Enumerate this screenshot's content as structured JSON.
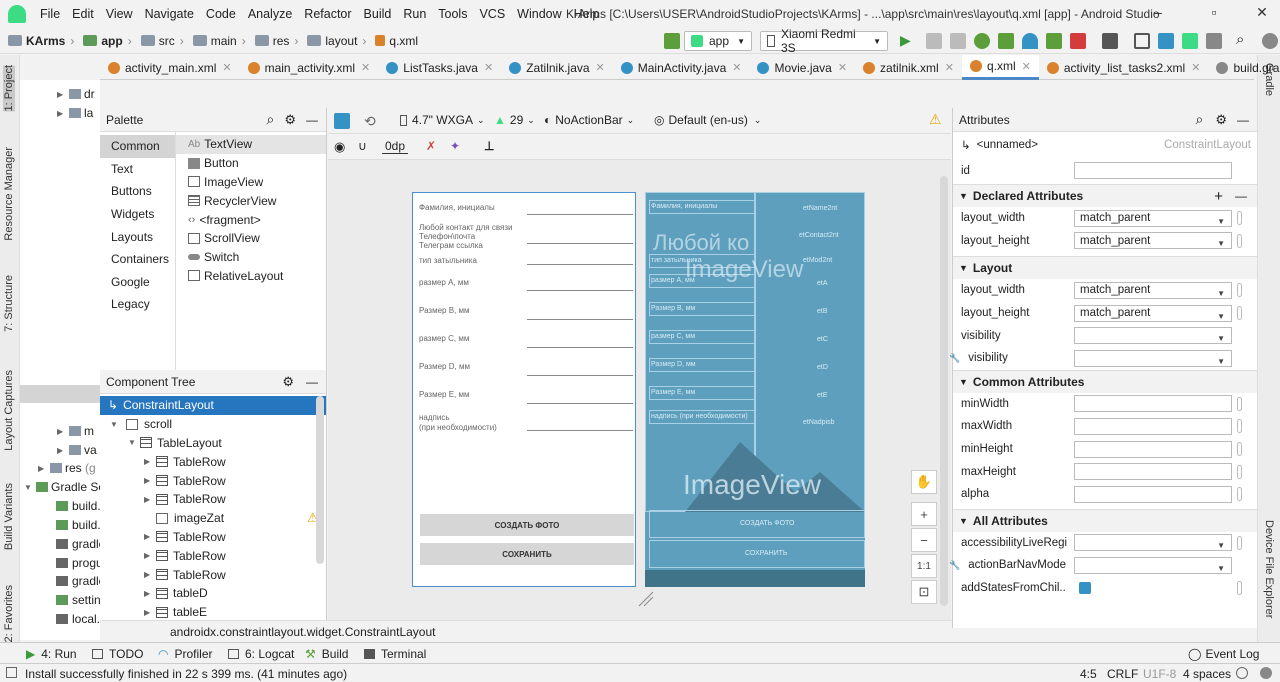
{
  "menubar": {
    "items": [
      "File",
      "Edit",
      "View",
      "Navigate",
      "Code",
      "Analyze",
      "Refactor",
      "Build",
      "Run",
      "Tools",
      "VCS",
      "Window",
      "Help"
    ],
    "title": "K-Arms [C:\\Users\\USER\\AndroidStudioProjects\\KArms] - ...\\app\\src\\main\\res\\layout\\q.xml [app] - Android Studio"
  },
  "breadcrumbs": [
    "KArms",
    "app",
    "src",
    "main",
    "res",
    "layout",
    "q.xml"
  ],
  "toolbar": {
    "run_config": "app",
    "device": "Xiaomi Redmi 3S"
  },
  "tabs": [
    {
      "label": "activity_main.xml",
      "color": "#d9822b"
    },
    {
      "label": "main_activity.xml",
      "color": "#d9822b"
    },
    {
      "label": "ListTasks.java",
      "color": "#3592c4"
    },
    {
      "label": "Zatilnik.java",
      "color": "#3592c4"
    },
    {
      "label": "MainActivity.java",
      "color": "#3592c4"
    },
    {
      "label": "Movie.java",
      "color": "#3592c4"
    },
    {
      "label": "zatilnik.xml",
      "color": "#d9822b"
    },
    {
      "label": "q.xml",
      "color": "#d9822b",
      "active": true
    },
    {
      "label": "activity_list_tasks2.xml",
      "color": "#d9822b"
    },
    {
      "label": "build.gra",
      "color": "#888888"
    }
  ],
  "left_strip": [
    "1: Project",
    "Resource Manager",
    "7: Structure",
    "Layout Captures",
    "Build Variants",
    "2: Favorites"
  ],
  "right_strip": [
    "Gradle",
    "Device File Explorer"
  ],
  "project": {
    "items": [
      "dr",
      "la",
      "m",
      "va",
      "res",
      "Gradle Sc",
      "build.",
      "build.",
      "gradle",
      "progu",
      "gradle",
      "settin",
      "local."
    ],
    "res_suffix": "(g"
  },
  "palette": {
    "title": "Palette",
    "categories": [
      "Common",
      "Text",
      "Buttons",
      "Widgets",
      "Layouts",
      "Containers",
      "Google",
      "Legacy"
    ],
    "widgets": [
      "TextView",
      "Button",
      "ImageView",
      "RecyclerView",
      "<fragment>",
      "ScrollView",
      "Switch",
      "RelativeLayout"
    ],
    "textview_prefix": "Ab"
  },
  "component_tree": {
    "title": "Component Tree",
    "rows": [
      "ConstraintLayout",
      "scroll",
      "TableLayout",
      "TableRow",
      "TableRow",
      "TableRow",
      "imageZat",
      "TableRow",
      "TableRow",
      "TableRow",
      "tableD",
      "tableE"
    ]
  },
  "design_toolbar": {
    "device": "4.7\" WXGA",
    "api": "29",
    "theme": "NoActionBar",
    "locale": "Default (en-us)",
    "margin": "0dp"
  },
  "phone": {
    "labels": [
      "Фамилия, инициалы",
      "Любой контакт для связи",
      "Телефон\\почта",
      "Телеграм ссылка",
      "тип затыльника",
      "размер А, мм",
      "Размер В, мм",
      "размер С, мм",
      "Размер D, мм",
      "Размер Е, мм",
      "надпись",
      "(при необходимости)"
    ],
    "buttons": [
      "СОЗДАТЬ ФОТО",
      "СОХРАНИТЬ"
    ]
  },
  "blueprint": {
    "left_labels": [
      "Фамилия, инициалы",
      "тип затыльника",
      "размер А, мм",
      "Размер В, мм",
      "размер С, мм",
      "Размер D, мм",
      "Размер Е, мм",
      "надпись (при необходимости)"
    ],
    "right_labels": [
      "etName2nt",
      "etContact2nt",
      "etMod2nt",
      "etA",
      "etB",
      "etC",
      "etD",
      "etE",
      "etNadpisb"
    ],
    "big_text_1": "Любой ко",
    "big_text_2": "ImageView",
    "image_view": "ImageView",
    "buttons": [
      "СОЗДАТЬ ФОТО",
      "СОХРАНИТЬ"
    ]
  },
  "zoom": {
    "one_to_one": "1:1"
  },
  "attributes": {
    "title": "Attributes",
    "component": "<unnamed>",
    "component_type": "ConstraintLayout",
    "id_label": "id",
    "sections": {
      "declared": "Declared Attributes",
      "layout": "Layout",
      "common": "Common Attributes",
      "all": "All Attributes"
    },
    "declared_rows": [
      {
        "name": "layout_width",
        "value": "match_parent"
      },
      {
        "name": "layout_height",
        "value": "match_parent"
      }
    ],
    "layout_rows": [
      {
        "name": "layout_width",
        "value": "match_parent"
      },
      {
        "name": "layout_height",
        "value": "match_parent"
      },
      {
        "name": "visibility",
        "value": ""
      },
      {
        "name": "visibility",
        "value": ""
      }
    ],
    "common_rows": [
      "minWidth",
      "maxWidth",
      "minHeight",
      "maxHeight",
      "alpha"
    ],
    "all_rows": [
      "accessibilityLiveRegi...",
      "actionBarNavMode",
      "addStatesFromChil..."
    ]
  },
  "breadcrumb_path": "androidx.constraintlayout.widget.ConstraintLayout",
  "toolwindows": [
    {
      "label": "4: Run"
    },
    {
      "label": "TODO"
    },
    {
      "label": "Profiler"
    },
    {
      "label": "6: Logcat"
    },
    {
      "label": "Build"
    },
    {
      "label": "Terminal"
    }
  ],
  "event_log": "Event Log",
  "status": {
    "message": "Install successfully finished in 22 s 399 ms. (41 minutes ago)",
    "position": "4:5",
    "line_sep": "CRLF",
    "encoding": "U1F-8",
    "indent": "4 spaces"
  },
  "colors": {
    "accent": "#2675bf",
    "blueprint": "#5e9fbd",
    "android_green": "#3ddc84",
    "warning": "#e5a50a"
  }
}
